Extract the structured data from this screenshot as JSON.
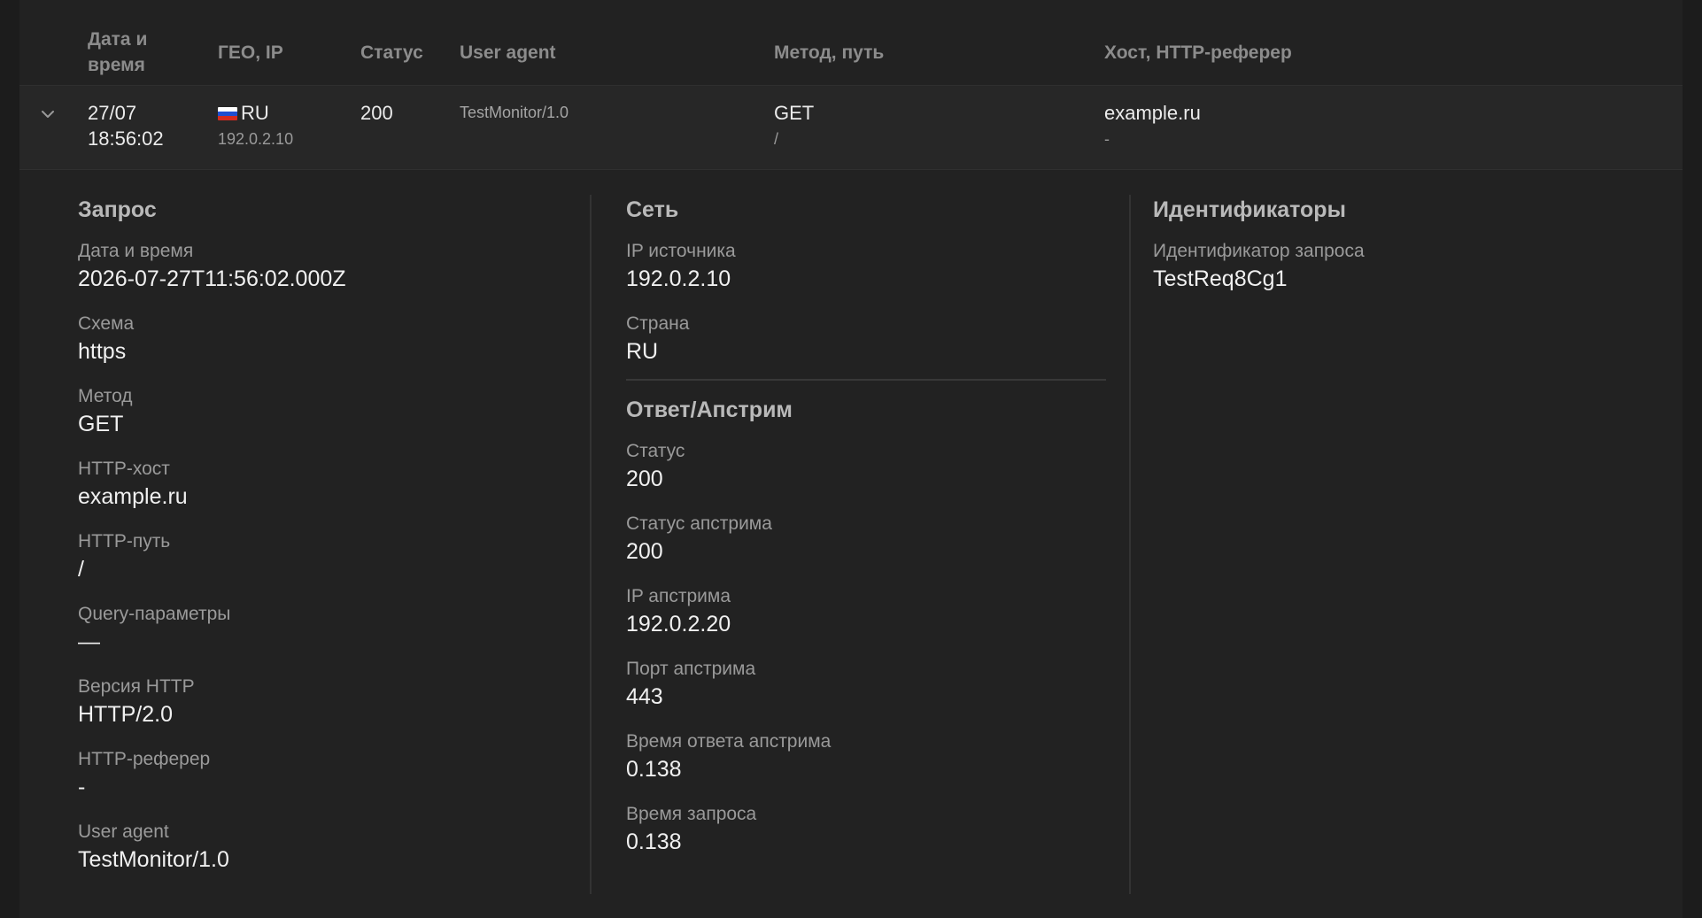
{
  "table": {
    "headers": {
      "datetime": "Дата и\nвремя",
      "datetime_l1": "Дата и",
      "datetime_l2": "время",
      "geo": "ГЕО, IP",
      "status": "Статус",
      "ua": "User agent",
      "method": "Метод, путь",
      "host": "Хост, HTTP-реферер"
    },
    "row": {
      "date": "27/07",
      "time": "18:56:02",
      "country": "RU",
      "ip": "192.0.2.10",
      "status": "200",
      "ua": "TestMonitor/1.0",
      "method": "GET",
      "path": "/",
      "host": "example.ru",
      "referer": "-"
    },
    "icons": {
      "expand": "chevron-down-icon",
      "flag": "flag-ru-icon"
    }
  },
  "details": {
    "request": {
      "title": "Запрос",
      "fields": [
        {
          "label": "Дата и время",
          "value": "2026-07-27T11:56:02.000Z"
        },
        {
          "label": "Схема",
          "value": "https"
        },
        {
          "label": "Метод",
          "value": "GET"
        },
        {
          "label": "HTTP-хост",
          "value": "example.ru"
        },
        {
          "label": "HTTP-путь",
          "value": "/"
        },
        {
          "label": "Query-параметры",
          "value": "—"
        },
        {
          "label": "Версия HTTP",
          "value": "HTTP/2.0"
        },
        {
          "label": "HTTP-реферер",
          "value": "-"
        },
        {
          "label": "User agent",
          "value": "TestMonitor/1.0"
        }
      ]
    },
    "network": {
      "title": "Сеть",
      "fields": [
        {
          "label": "IP источника",
          "value": "192.0.2.10"
        },
        {
          "label": "Страна",
          "value": "RU"
        }
      ]
    },
    "upstream": {
      "title": "Ответ/Апстрим",
      "fields": [
        {
          "label": "Статус",
          "value": "200"
        },
        {
          "label": "Статус апстрима",
          "value": "200"
        },
        {
          "label": "IP апстрима",
          "value": "192.0.2.20"
        },
        {
          "label": "Порт апстрима",
          "value": "443"
        },
        {
          "label": "Время ответа апстрима",
          "value": "0.138"
        },
        {
          "label": "Время запроса",
          "value": "0.138"
        }
      ]
    },
    "ids": {
      "title": "Идентификаторы",
      "fields": [
        {
          "label": "Идентификатор запроса",
          "value": "TestReq8Cg1"
        }
      ]
    }
  },
  "colors": {
    "background": "#222222",
    "row_background": "#272727",
    "flag_white": "#ffffff",
    "flag_blue": "#1f4fd1",
    "flag_red": "#d52b1e"
  }
}
